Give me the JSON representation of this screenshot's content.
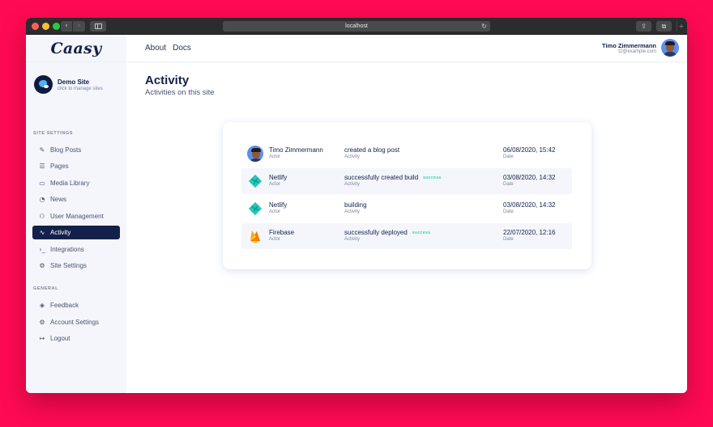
{
  "browser": {
    "url": "localhost"
  },
  "sidebar": {
    "logo": "Caasy",
    "site": {
      "name": "Demo Site",
      "subtitle": "click to manage sites"
    },
    "sections": [
      {
        "label": "SITE SETTINGS",
        "items": [
          {
            "label": "Blog Posts",
            "icon": "edit-icon"
          },
          {
            "label": "Pages",
            "icon": "list-icon"
          },
          {
            "label": "Media Library",
            "icon": "folder-icon"
          },
          {
            "label": "News",
            "icon": "rss-icon"
          },
          {
            "label": "User Management",
            "icon": "users-icon"
          },
          {
            "label": "Activity",
            "icon": "activity-icon",
            "active": true
          },
          {
            "label": "Integrations",
            "icon": "terminal-icon"
          },
          {
            "label": "Site Settings",
            "icon": "gear-icon"
          }
        ]
      },
      {
        "label": "GENERAL",
        "items": [
          {
            "label": "Feedback",
            "icon": "feedback-icon"
          },
          {
            "label": "Account Settings",
            "icon": "gear-icon"
          },
          {
            "label": "Logout",
            "icon": "logout-icon"
          }
        ]
      }
    ]
  },
  "header": {
    "nav": [
      "About",
      "Docs"
    ],
    "user": {
      "name": "Timo Zimmermann",
      "email": "t2@example.com"
    }
  },
  "page": {
    "title": "Activity",
    "subtitle": "Activities on this site"
  },
  "activity": {
    "actor_label": "Actor",
    "activity_label": "Activity",
    "date_label": "Date",
    "rows": [
      {
        "actor": "Timo Zimmermann",
        "actor_icon": "user-avatar",
        "activity": "created a blog post",
        "badge": "",
        "date": "06/08/2020, 15:42"
      },
      {
        "actor": "Netlify",
        "actor_icon": "netlify-icon",
        "activity": "successfully created build",
        "badge": "success",
        "date": "03/08/2020, 14:32"
      },
      {
        "actor": "Netlify",
        "actor_icon": "netlify-icon",
        "activity": "building",
        "badge": "",
        "date": "03/08/2020, 14:32"
      },
      {
        "actor": "Firebase",
        "actor_icon": "firebase-icon",
        "activity": "successfully deployed",
        "badge": "success",
        "date": "22/07/2020, 12:16"
      }
    ]
  },
  "colors": {
    "background": "#fe0a52",
    "primary": "#13204a",
    "success": "#2fd3b2"
  }
}
